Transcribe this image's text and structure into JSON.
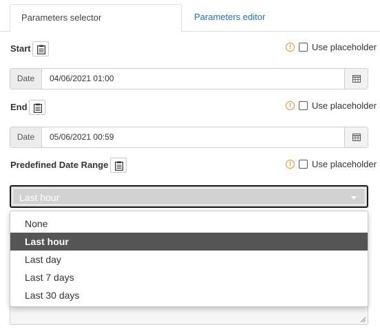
{
  "tabs": [
    {
      "label": "Parameters selector",
      "active": true
    },
    {
      "label": "Parameters editor",
      "active": false
    }
  ],
  "fields": {
    "start": {
      "label": "Start",
      "placeholder_label": "Use placeholder",
      "date_addon": "Date",
      "value": "04/06/2021 01:00"
    },
    "end": {
      "label": "End",
      "placeholder_label": "Use placeholder",
      "date_addon": "Date",
      "value": "05/06/2021 00:59"
    },
    "range": {
      "label": "Predefined Date Range",
      "placeholder_label": "Use placeholder",
      "selected": "Last hour",
      "options": [
        "None",
        "Last hour",
        "Last day",
        "Last 7 days",
        "Last 30 days"
      ]
    }
  },
  "icons": {
    "clipboard": "clipboard-icon",
    "warning": "warning-icon",
    "calendar": "calendar-icon",
    "caret": "caret-down-icon"
  },
  "colors": {
    "link": "#2a6fa8",
    "warning": "#e98b2a",
    "selected_option_bg": "#555555"
  }
}
